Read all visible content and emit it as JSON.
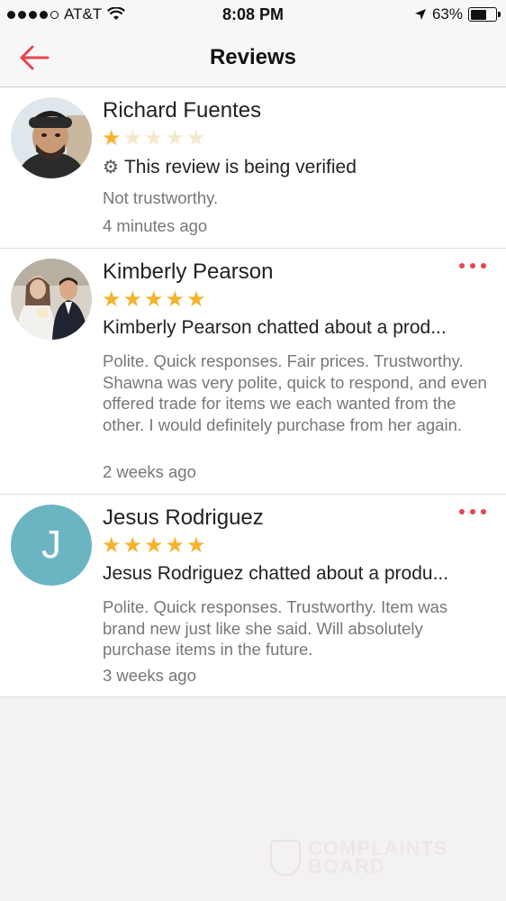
{
  "status_bar": {
    "carrier": "AT&T",
    "time": "8:08 PM",
    "battery": "63%",
    "battery_level": 0.63,
    "signal_bars": 4
  },
  "nav": {
    "title": "Reviews",
    "back_icon": "back-arrow-icon"
  },
  "colors": {
    "accent": "#e8434f",
    "star": "#f6b22c",
    "avatar_bg": "#6bb5c3"
  },
  "reviews": [
    {
      "name": "Richard Fuentes",
      "rating": 1,
      "headline": "This review is being verified",
      "headline_icon": "gear-icon",
      "body": "Not trustworthy.",
      "time": "4 minutes ago"
    },
    {
      "name": "Kimberly Pearson",
      "rating": 5,
      "headline": "Kimberly Pearson chatted about a prod...",
      "body": "Polite. Quick responses. Fair prices. Trustworthy. Shawna was very polite, quick to respond, and even offered trade for items we each wanted from the other.  I would definitely purchase from her again.",
      "time": "2 weeks ago"
    },
    {
      "name": "Jesus Rodriguez",
      "avatar_letter": "J",
      "rating": 5,
      "headline": "Jesus Rodriguez chatted about a produ...",
      "body": "Polite. Quick responses. Trustworthy. Item was brand new just like she said. Will absolutely purchase items in the future.",
      "time": "3 weeks ago"
    }
  ],
  "watermark": {
    "line1": "COMPLAINTS",
    "line2": "BOARD"
  }
}
